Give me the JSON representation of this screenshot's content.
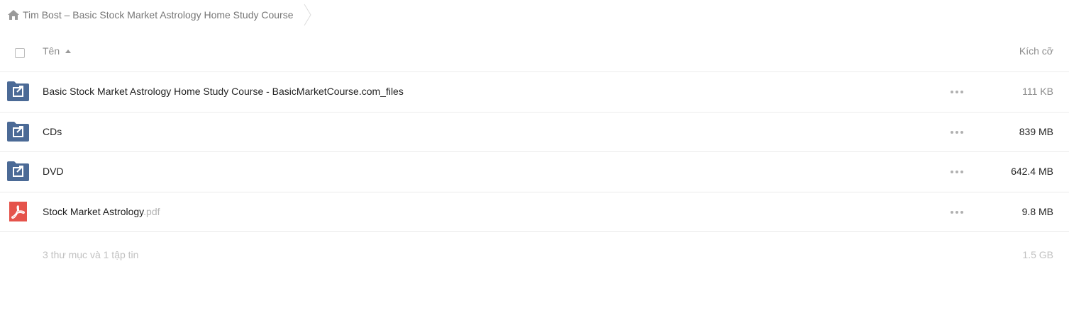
{
  "breadcrumb": {
    "home_icon": "home-icon",
    "label": "Tim Bost – Basic Stock Market Astrology Home Study Course"
  },
  "header": {
    "name_label": "Tên",
    "size_label": "Kích cỡ",
    "sort_icon": "sort-ascending-icon"
  },
  "files": [
    {
      "name": "Basic Stock Market Astrology Home Study Course - BasicMarketCourse.com_files",
      "ext": "",
      "size": "111 KB",
      "icon": "shared-folder-icon"
    },
    {
      "name": "CDs",
      "ext": "",
      "size": "839 MB",
      "icon": "shared-folder-icon"
    },
    {
      "name": "DVD",
      "ext": "",
      "size": "642.4 MB",
      "icon": "shared-folder-icon"
    },
    {
      "name": "Stock Market Astrology",
      "ext": ".pdf",
      "size": "9.8 MB",
      "icon": "pdf-file-icon"
    }
  ],
  "summary": {
    "counts": "3 thư mục và 1 tập tin",
    "total_size": "1.5 GB"
  },
  "colors": {
    "folder": "#4b6a96",
    "pdf": "#e5534b",
    "muted_text": "#8c8c8c",
    "divider": "#ececec"
  }
}
